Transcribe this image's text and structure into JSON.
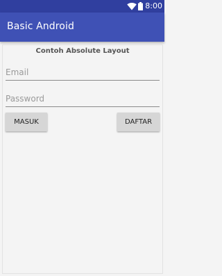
{
  "status_bar": {
    "time": "8:00",
    "icons": [
      "wifi-icon",
      "battery-icon"
    ]
  },
  "app_bar": {
    "title": "Basic Android"
  },
  "form": {
    "heading": "Contoh Absolute Layout",
    "email_placeholder": "Email",
    "password_placeholder": "Password",
    "masuk_label": "MASUK",
    "daftar_label": "DAFTAR"
  },
  "colors": {
    "status_bar": "#303f9f",
    "app_bar": "#3f51b5",
    "background": "#f4f4f4",
    "button": "#d6d6d6"
  }
}
